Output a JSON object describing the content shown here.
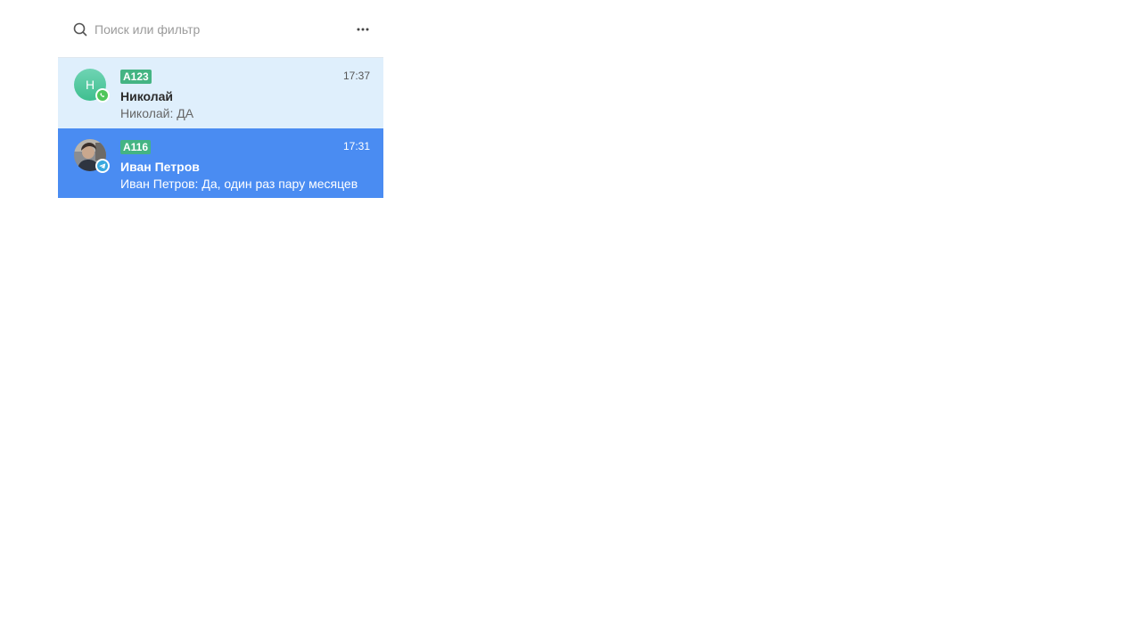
{
  "search": {
    "placeholder": "Поиск или фильтр",
    "value": ""
  },
  "menu": {
    "icon": "more-horizontal-icon"
  },
  "colors": {
    "hover_row": "#dfeffc",
    "active_row": "#4a8cf2",
    "tag_green": "#44b483",
    "whatsapp": "#4fc65a",
    "telegram": "#38a8df"
  },
  "chats": [
    {
      "avatar_letter": "Н",
      "avatar_type": "letter",
      "channel": "whatsapp",
      "channel_icon": "whatsapp-icon",
      "tag": "A123",
      "time": "17:37",
      "name": "Николай",
      "preview": "Николай: ДА",
      "state": "hover"
    },
    {
      "avatar_type": "photo",
      "channel": "telegram",
      "channel_icon": "telegram-icon",
      "tag": "A116",
      "time": "17:31",
      "name": "Иван Петров",
      "preview": "Иван Петров: Да, один раз пару месяцев",
      "state": "active"
    }
  ]
}
